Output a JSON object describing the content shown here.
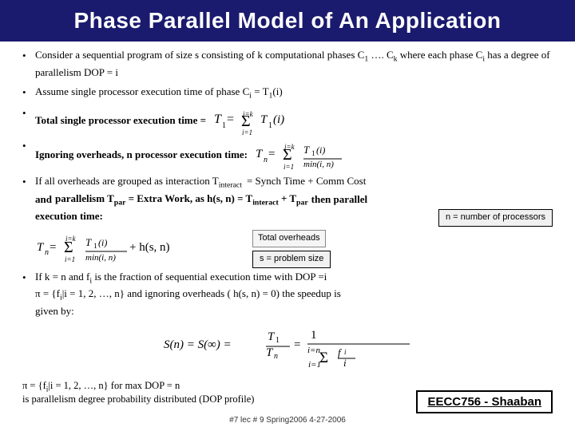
{
  "title": "Phase Parallel Model of An Application",
  "bullets": [
    {
      "id": "b1",
      "text_parts": [
        {
          "t": "Consider a sequential program of size s consisting of  k computational phases  C",
          "style": "normal"
        },
        {
          "t": "1",
          "style": "sub"
        },
        {
          "t": " …. C",
          "style": "normal"
        },
        {
          "t": "k",
          "style": "sub"
        },
        {
          "t": "  where each phase C",
          "style": "normal"
        },
        {
          "t": "i",
          "style": "sub"
        },
        {
          "t": "  has a degree of parallelism DOP = i",
          "style": "normal"
        }
      ]
    },
    {
      "id": "b2",
      "text_parts": [
        {
          "t": "Assume single processor execution time of phase  C",
          "style": "normal"
        },
        {
          "t": "i",
          "style": "sub"
        },
        {
          "t": "  = T",
          "style": "normal"
        },
        {
          "t": "1",
          "style": "sub"
        },
        {
          "t": "(i)",
          "style": "normal"
        }
      ]
    },
    {
      "id": "b3",
      "bold": true,
      "text_parts": [
        {
          "t": "Total single processor execution time = ",
          "style": "bold"
        }
      ],
      "has_formula": true,
      "formula_id": "f1"
    },
    {
      "id": "b4",
      "bold": true,
      "text_parts": [
        {
          "t": "Ignoring overheads, n processor execution time:",
          "style": "bold"
        }
      ],
      "has_formula": true,
      "formula_id": "f2"
    },
    {
      "id": "b5",
      "text_parts": [
        {
          "t": "If all overheads are grouped as interaction T",
          "style": "normal"
        },
        {
          "t": "interact",
          "style": "sub"
        },
        {
          "t": "  = Synch Time + Comm Cost",
          "style": "normal"
        }
      ],
      "line2": [
        {
          "t": "and",
          "style": "bold"
        },
        {
          "t": " parallelism T",
          "style": "bold"
        },
        {
          "t": "par",
          "style": "sub-bold"
        },
        {
          "t": " = Extra Work,  as  h(s, n)  = T",
          "style": "bold"
        },
        {
          "t": "interact",
          "style": "sub-bold"
        },
        {
          "t": " + T",
          "style": "bold"
        },
        {
          "t": "par",
          "style": "sub-bold"
        },
        {
          "t": "  ",
          "style": "bold"
        },
        {
          "t": "then parallel",
          "style": "bold"
        }
      ],
      "line3": "execution time:"
    },
    {
      "id": "b6",
      "text_parts": [
        {
          "t": "If  k = n  and  f",
          "style": "normal"
        },
        {
          "t": "i",
          "style": "sub"
        },
        {
          "t": "  is the fraction of sequential execution time with DOP =i",
          "style": "normal"
        }
      ],
      "line2_plain": "π = {f",
      "line2_pi": "i",
      "line2_rest": "|i = 1, 2, …, n}  and ignoring overheads ( h(s, n) =  0) the speedup is",
      "line3": "given by:"
    }
  ],
  "pi_bottom": {
    "line1": "π = {f",
    "line1_sub": "i",
    "line1_rest": "|i = 1, 2, …, n}  for max DOP = n",
    "line2": "is parallelism degree probability distributed (DOP profile)"
  },
  "boxes": {
    "n_processors": "n = number of processors",
    "s_problem": "s = problem size",
    "total_overheads": "Total overheads"
  },
  "eecc": "EECC756 - Shaaban",
  "footer": "#7   lec # 9    Spring2006   4-27-2006",
  "colors": {
    "title_bg": "#1a1a6e",
    "title_text": "#ffffff"
  }
}
